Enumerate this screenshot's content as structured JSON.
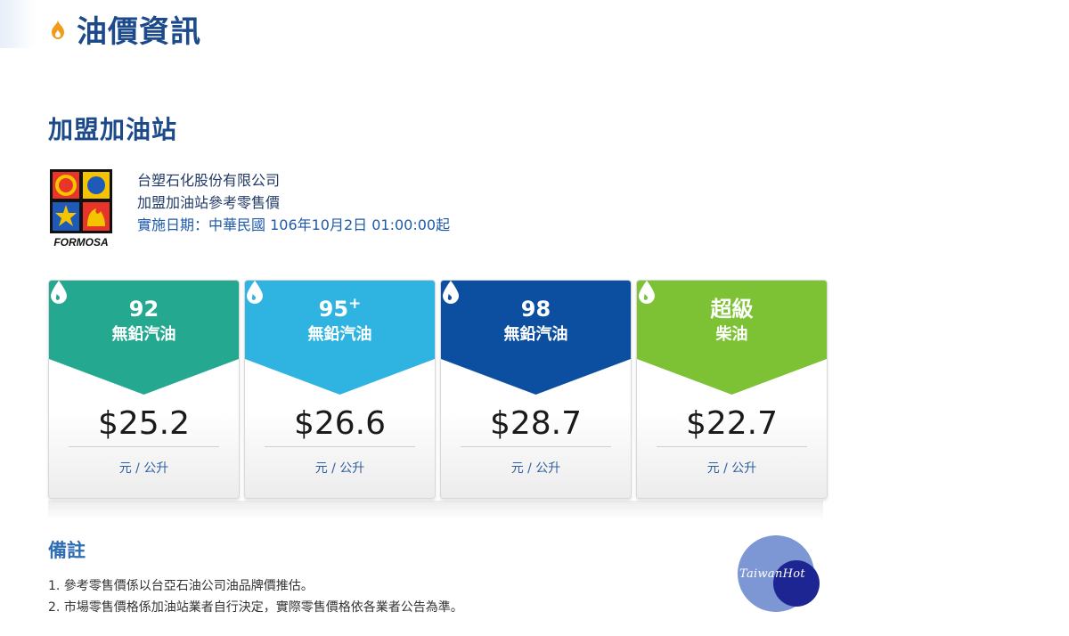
{
  "header": {
    "title": "油價資訊",
    "icon": "flame-icon",
    "icon_color": "#f29a1c"
  },
  "section": {
    "title": "加盟加油站"
  },
  "company": {
    "logo_text": "FORMOSA",
    "name": "台塑石化股份有限公司",
    "subtitle": "加盟加油站參考零售價",
    "effective_date": "實施日期：中華民國 106年10月2日 01:00:00起"
  },
  "prices": [
    {
      "grade": "92",
      "grade_sup": "",
      "fuel": "無鉛汽油",
      "price": "$25.2",
      "unit": "元 / 公升",
      "color": "#24a890"
    },
    {
      "grade": "95",
      "grade_sup": "+",
      "fuel": "無鉛汽油",
      "price": "$26.6",
      "unit": "元 / 公升",
      "color": "#2fb4e2"
    },
    {
      "grade": "98",
      "grade_sup": "",
      "fuel": "無鉛汽油",
      "price": "$28.7",
      "unit": "元 / 公升",
      "color": "#0c4fa0"
    },
    {
      "grade": "超級",
      "grade_sup": "",
      "fuel": "柴油",
      "price": "$22.7",
      "unit": "元 / 公升",
      "color": "#7cc234"
    }
  ],
  "notes": {
    "title": "備註",
    "items": [
      "1. 參考零售價係以台亞石油公司油品牌價推估。",
      "2. 市場零售價格係加油站業者自行決定，實際零售價格依各業者公告為準。"
    ]
  },
  "watermark": {
    "text": "TaiwanHot"
  }
}
